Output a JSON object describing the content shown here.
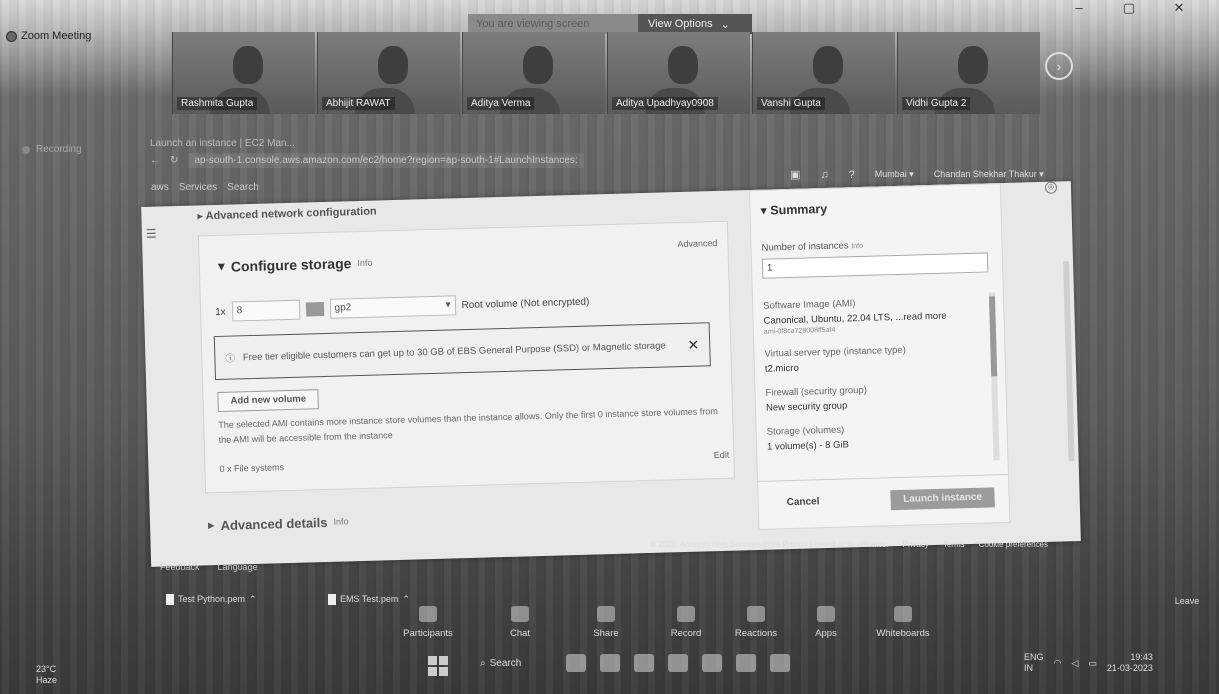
{
  "window": {
    "title": "Zoom Meeting",
    "controls": [
      "–",
      "▢",
      "✕"
    ]
  },
  "view_bar": {
    "talking_text": "You are viewing screen",
    "view_options": "View Options",
    "chevron": "⌄"
  },
  "participants": [
    {
      "name": "Rashmita Gupta"
    },
    {
      "name": "Abhijit RAWAT"
    },
    {
      "name": "Aditya Verma"
    },
    {
      "name": "Aditya Upadhyay0908"
    },
    {
      "name": "Vanshi Gupta"
    },
    {
      "name": "Vidhi Gupta 2"
    }
  ],
  "strip_next": "›",
  "browser": {
    "recording": "Recording",
    "tab_label": "Launch an instance | EC2 Man...",
    "url": "ap-south-1.console.aws.amazon.com/ec2/home?region=ap-south-1#LaunchInstances:",
    "aws_items": [
      "aws",
      "Services",
      "Search"
    ],
    "right_items": [
      "Mumbai ▾",
      "Chandan Shekhar Thakur ▾"
    ]
  },
  "storage": {
    "adv_network": "▸ Advanced network configuration",
    "title": "Configure storage",
    "info": "Info",
    "advanced": "Advanced",
    "qty": "1x",
    "size": "8",
    "unit": "GiB",
    "type": "gp2",
    "root_label": "Root volume  (Not encrypted)",
    "notice": "Free tier eligible customers can get up to 30 GB of EBS General Purpose (SSD) or Magnetic storage",
    "notice_close": "✕",
    "add_volume": "Add new volume",
    "ami_message": "The selected AMI contains more instance store volumes than the instance allows. Only the first 0 instance store volumes from the AMI will be accessible from the instance",
    "file_systems": "0 x File systems",
    "edit": "Edit"
  },
  "advanced_details": {
    "label": "Advanced details",
    "info": "Info"
  },
  "summary": {
    "title": "Summary",
    "num_instances_label": "Number of instances",
    "num_instances_info": "Info",
    "num_instances_value": "1",
    "items": [
      {
        "label": "Software Image (AMI)",
        "value": "Canonical, Ubuntu, 22.04 LTS, ...read more",
        "sub": "ami-0f8ca728008ff5af4"
      },
      {
        "label": "Virtual server type (instance type)",
        "value": "t2.micro",
        "sub": ""
      },
      {
        "label": "Firewall (security group)",
        "value": "New security group",
        "sub": ""
      },
      {
        "label": "Storage (volumes)",
        "value": "1 volume(s) - 8 GiB",
        "sub": ""
      }
    ],
    "cancel": "Cancel",
    "launch": "Launch instance"
  },
  "aws_footer": [
    "© 2023, Amazon Web Services India Private Limited or its affiliates.",
    "Privacy",
    "Terms",
    "Cookie preferences"
  ],
  "aws_bottom_left": [
    "Feedback",
    "Language"
  ],
  "files": [
    "Test Python.pem",
    "EMS Test.pem"
  ],
  "zoom_controls": [
    {
      "label": "Participants"
    },
    {
      "label": "Chat"
    },
    {
      "label": "Share"
    },
    {
      "label": "Record"
    },
    {
      "label": "Reactions"
    },
    {
      "label": "Apps"
    },
    {
      "label": "Whiteboards"
    }
  ],
  "leave": "Leave",
  "taskbar": {
    "weather_temp": "23°C",
    "weather_desc": "Haze",
    "search": "Search",
    "lang": "ENG",
    "lang_sub": "IN",
    "time": "19:43",
    "date": "21-03-2023"
  }
}
